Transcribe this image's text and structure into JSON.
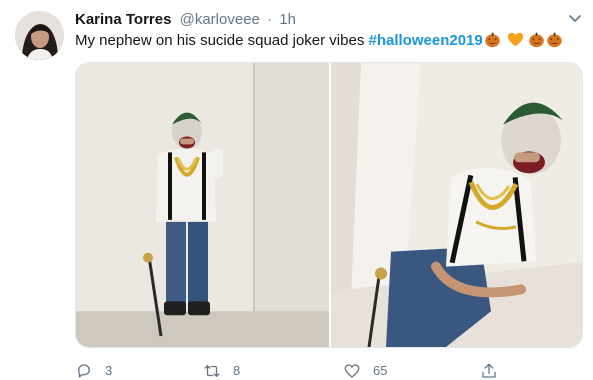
{
  "tweet": {
    "author": {
      "display_name": "Karina Torres",
      "handle": "@karloveee",
      "separator": "·",
      "timestamp": "1h"
    },
    "text": {
      "body": "My nephew on his sucide squad joker vibes ",
      "hashtag": "#halloween2019",
      "emojis": [
        "jack-o-lantern",
        "orange-heart",
        "jack-o-lantern",
        "jack-o-lantern"
      ]
    },
    "media": {
      "photos": [
        {
          "alt": "boy in joker costume leaning on cane"
        },
        {
          "alt": "boy in joker costume with cane, close up"
        }
      ]
    },
    "actions": {
      "reply_count": "3",
      "retweet_count": "8",
      "like_count": "65"
    }
  },
  "icons": [
    "chevron-down-icon",
    "reply-icon",
    "retweet-icon",
    "like-icon",
    "share-icon"
  ],
  "colors": {
    "hashtag": "#1b95e0",
    "secondary_text": "#657786",
    "primary_text": "#14171a"
  }
}
